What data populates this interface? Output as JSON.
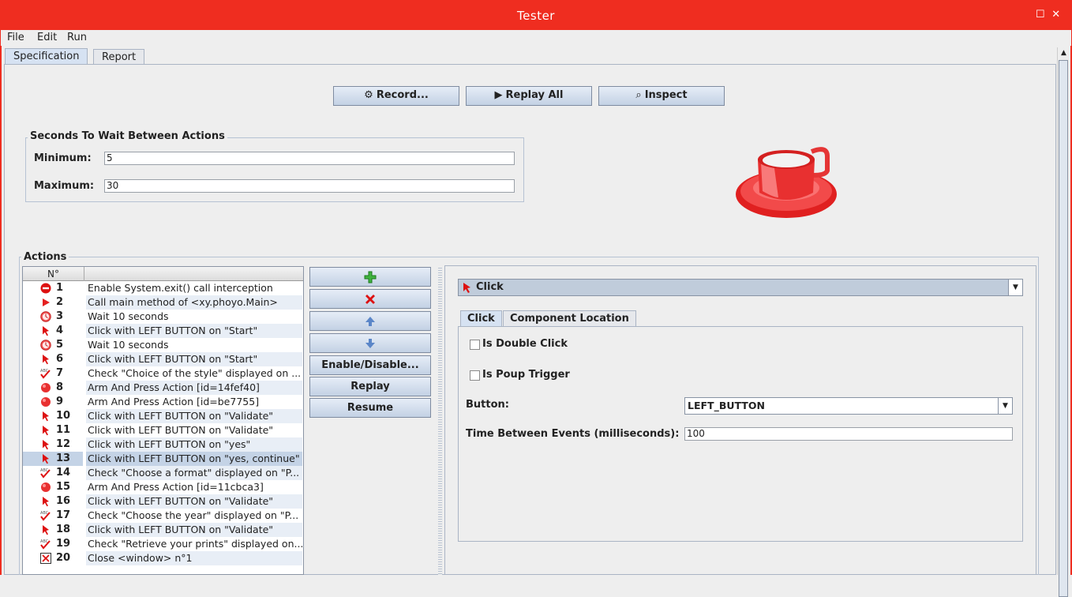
{
  "window": {
    "title": "Tester"
  },
  "menu": [
    "File",
    "Edit",
    "Run"
  ],
  "tabs": [
    "Specification",
    "Report"
  ],
  "toolbar": {
    "record": "Record...",
    "replay_all": "Replay All",
    "inspect": "Inspect"
  },
  "wait": {
    "title": "Seconds To Wait Between Actions",
    "min_label": "Minimum:",
    "min_value": "5",
    "max_label": "Maximum:",
    "max_value": "30"
  },
  "actions": {
    "title": "Actions",
    "column": "N°",
    "rows": [
      {
        "n": "1",
        "icon": "stop-icon",
        "text": "Enable System.exit() call interception"
      },
      {
        "n": "2",
        "icon": "play-icon",
        "text": "Call main method of <xy.phoyo.Main>"
      },
      {
        "n": "3",
        "icon": "clock-icon",
        "text": "Wait 10 seconds"
      },
      {
        "n": "4",
        "icon": "cursor-icon",
        "text": "Click with LEFT BUTTON on \"Start\""
      },
      {
        "n": "5",
        "icon": "clock-icon",
        "text": "Wait 10 seconds"
      },
      {
        "n": "6",
        "icon": "cursor-icon",
        "text": "Click with LEFT BUTTON on \"Start\""
      },
      {
        "n": "7",
        "icon": "check-abc-icon",
        "text": "Check \"Choice of the style\" displayed on ..."
      },
      {
        "n": "8",
        "icon": "red-dot-icon",
        "text": "Arm And Press Action [id=14fef40]"
      },
      {
        "n": "9",
        "icon": "red-dot-icon",
        "text": "Arm And Press Action [id=be7755]"
      },
      {
        "n": "10",
        "icon": "cursor-icon",
        "text": "Click with LEFT BUTTON on \"Validate\""
      },
      {
        "n": "11",
        "icon": "cursor-icon",
        "text": "Click with LEFT BUTTON on \"Validate\""
      },
      {
        "n": "12",
        "icon": "cursor-icon",
        "text": "Click with LEFT BUTTON on \"yes\""
      },
      {
        "n": "13",
        "icon": "cursor-icon",
        "text": "Click with LEFT BUTTON on \"yes, continue\""
      },
      {
        "n": "14",
        "icon": "check-abc-icon",
        "text": "Check \"Choose a format\" displayed on \"P..."
      },
      {
        "n": "15",
        "icon": "red-dot-icon",
        "text": "Arm And Press Action [id=11cbca3]"
      },
      {
        "n": "16",
        "icon": "cursor-icon",
        "text": "Click with LEFT BUTTON on \"Validate\""
      },
      {
        "n": "17",
        "icon": "check-abc-icon",
        "text": "Check \"Choose the year\" displayed on \"P..."
      },
      {
        "n": "18",
        "icon": "cursor-icon",
        "text": "Click with LEFT BUTTON on \"Validate\""
      },
      {
        "n": "19",
        "icon": "check-abc-icon",
        "text": "Check \"Retrieve your prints\" displayed on..."
      },
      {
        "n": "20",
        "icon": "close-window-icon",
        "text": "Close <window> n°1"
      }
    ],
    "selected_row": "13"
  },
  "side_buttons": {
    "add": "add-icon",
    "remove": "remove-icon",
    "up": "arrow-up-icon",
    "down": "arrow-down-icon",
    "enable": "Enable/Disable...",
    "replay": "Replay",
    "resume": "Resume"
  },
  "detail": {
    "action_type": "Click",
    "tabs": [
      "Click",
      "Component Location"
    ],
    "double_click": "Is Double Click",
    "popup_trigger": "Is Poup Trigger",
    "button_label": "Button:",
    "button_value": "LEFT_BUTTON",
    "time_label": "Time Between Events (milliseconds):",
    "time_value": "100"
  },
  "colors": {
    "titlebar": "#ef2d20",
    "selection": "#c4d3e6",
    "accent": "#ee1111"
  }
}
